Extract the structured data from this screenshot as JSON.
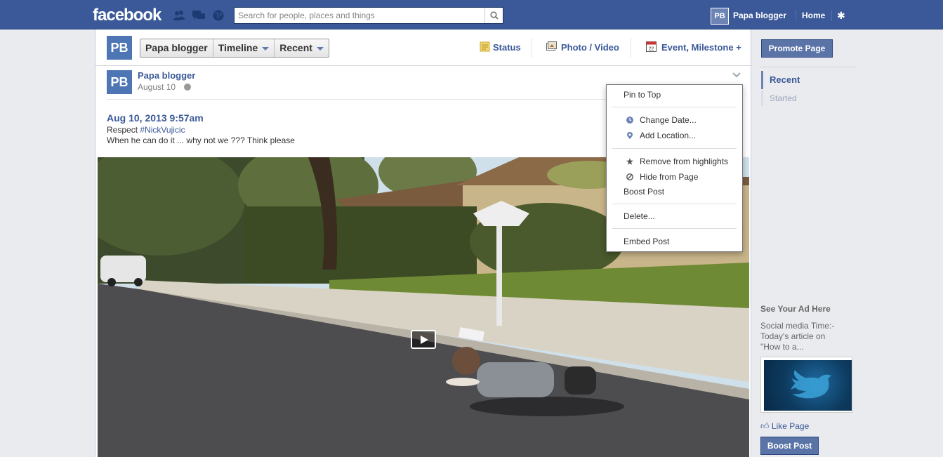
{
  "topbar": {
    "logo": "facebook",
    "search_placeholder": "Search for people, places and things",
    "icons": [
      "friend-requests-icon",
      "messages-icon",
      "notifications-globe-icon",
      "search-icon",
      "gear-icon"
    ],
    "user_avatar_text": "PB",
    "user_name": "Papa blogger",
    "home_label": "Home"
  },
  "composer": {
    "avatar_text": "PB",
    "page_name_button": "Papa blogger",
    "timeline_label": "Timeline",
    "recent_label": "Recent",
    "actions": {
      "status": "Status",
      "photo_video": "Photo / Video",
      "event_milestone": "Event, Milestone +"
    },
    "calendar_day": "22"
  },
  "post": {
    "avatar_text": "PB",
    "author": "Papa blogger",
    "date": "August 10",
    "story_time": "Aug 10, 2013 9:57am",
    "line1_prefix": "Respect ",
    "hashtag": "#NickVujicic",
    "line2": "When he can do it ... why not we ??? Think please"
  },
  "menu": {
    "items": [
      "Pin to Top",
      "Change Date...",
      "Add Location...",
      "Remove from highlights",
      "Hide from Page",
      "Boost Post",
      "Delete...",
      "Embed Post"
    ]
  },
  "sidebar": {
    "promote_label": "Promote Page",
    "recent_label": "Recent",
    "started_label": "Started",
    "ad_heading": "See Your Ad Here",
    "ad_line1": "Social media Time:-",
    "ad_line2": "Today's article on",
    "ad_line3": "\"How to a...",
    "like_page_label": "Like Page",
    "boost_label": "Boost Post"
  },
  "colors": {
    "brand_blue": "#3b5998",
    "button_blue": "#5b74a8",
    "background": "#e9ebee"
  }
}
